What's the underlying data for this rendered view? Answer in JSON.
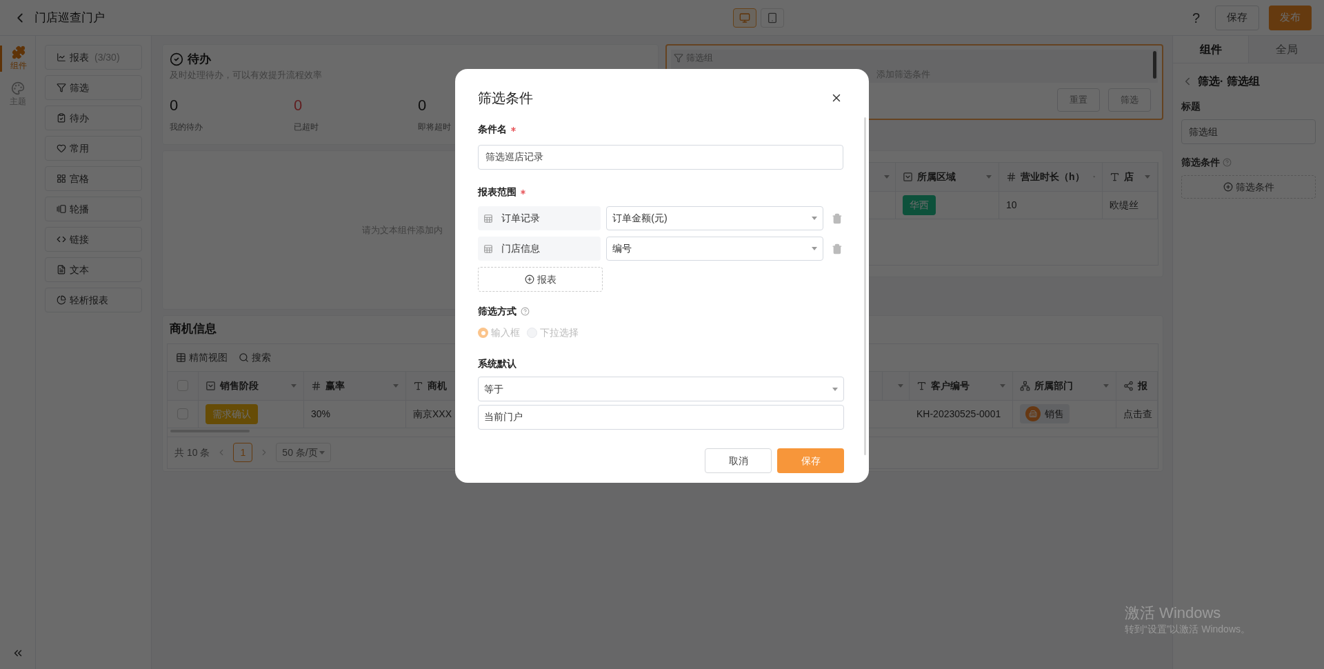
{
  "header": {
    "title": "门店巡查门户",
    "devices": [
      {
        "kind": "desktop",
        "selected": true
      },
      {
        "kind": "mobile",
        "selected": false
      }
    ],
    "help": "?",
    "buttons": [
      {
        "label": "保存",
        "kind": "default"
      },
      {
        "label": "发布",
        "kind": "primary"
      }
    ]
  },
  "rail": {
    "items": [
      {
        "label": "组件",
        "kind": "puzzle",
        "selected": true
      },
      {
        "label": "主题",
        "kind": "palette",
        "selected": false
      }
    ]
  },
  "components": [
    {
      "label": "报表",
      "count": "(3/30)",
      "kind": "chart"
    },
    {
      "label": "筛选",
      "kind": "filter"
    },
    {
      "label": "待办",
      "kind": "todo"
    },
    {
      "label": "常用",
      "kind": "heart"
    },
    {
      "label": "宫格",
      "kind": "grid"
    },
    {
      "label": "轮播",
      "kind": "carousel"
    },
    {
      "label": "链接",
      "kind": "code"
    },
    {
      "label": "文本",
      "kind": "text"
    },
    {
      "label": "轻析报表",
      "kind": "analysis"
    }
  ],
  "todo": {
    "title": "待办",
    "subtitle": "及时处理待办，可以有效提升流程效率",
    "stats": [
      {
        "value": "0",
        "label": "我的待办",
        "alert": false
      },
      {
        "value": "0",
        "label": "已超时",
        "alert": true
      },
      {
        "value": "0",
        "label": "即将超时",
        "alert": false
      }
    ]
  },
  "filter_group": {
    "title": "筛选组",
    "placeholder": "添加筛选条件",
    "buttons": [
      "重置",
      "筛选"
    ]
  },
  "text_card": {
    "placeholder": "请为文本组件添加内"
  },
  "store_table": {
    "columns": [
      {
        "label": "所属区域",
        "kind": "select"
      },
      {
        "label": "营业时长（h）",
        "kind": "number"
      },
      {
        "label": "店",
        "kind": "text"
      }
    ],
    "row": [
      {
        "kind": "green_tag",
        "text": "华西"
      },
      {
        "kind": "text",
        "text": "10"
      },
      {
        "kind": "text",
        "text": "欧缇丝"
      }
    ]
  },
  "opportunity": {
    "title": "商机信息",
    "toolbar": [
      {
        "label": "精简视图",
        "kind": "grid"
      },
      {
        "label": "搜索",
        "kind": "search"
      }
    ],
    "left_columns": [
      {
        "label": "销售阶段",
        "kind": "select"
      },
      {
        "label": "赢率",
        "kind": "number"
      },
      {
        "label": "商机",
        "kind": "text"
      }
    ],
    "all_checked": false,
    "row_checked": false,
    "left_row": [
      {
        "kind": "gold_tag",
        "text": "需求确认"
      },
      {
        "kind": "text",
        "text": "30%"
      },
      {
        "kind": "text",
        "text": "南京XXX"
      }
    ],
    "right_columns": [
      {
        "label": "客户编号",
        "kind": "text"
      },
      {
        "label": "所属部门",
        "kind": "org"
      },
      {
        "label": "报",
        "kind": "nodes"
      }
    ],
    "right_row": [
      {
        "kind": "text",
        "text": "KH-20230525-0001"
      },
      {
        "kind": "dept",
        "text": "销售"
      },
      {
        "kind": "text",
        "text": "点击查"
      }
    ],
    "pagination": {
      "total": "共 10 条",
      "pages": [
        {
          "label": "1",
          "selected": true
        }
      ],
      "page_size": "50 条/页"
    }
  },
  "right_panel": {
    "tabs": [
      {
        "label": "组件",
        "selected": true
      },
      {
        "label": "全局",
        "selected": false
      }
    ],
    "breadcrumb": "筛选· 筛选组",
    "title_label": "标题",
    "title_value": "筛选组",
    "conditions_label": "筛选条件",
    "add_condition": "筛选条件"
  },
  "dialog": {
    "title": "筛选条件",
    "name_label": "条件名",
    "name_required": true,
    "name_value": "筛选巡店记录",
    "scope_label": "报表范围",
    "scope_required": true,
    "scope_rows": [
      {
        "report": "订单记录",
        "field": "订单金额(元)"
      },
      {
        "report": "门店信息",
        "field": "编号"
      }
    ],
    "add_report": "报表",
    "mode_label": "筛选方式",
    "mode_disabled": true,
    "mode_options": [
      {
        "label": "输入框",
        "selected": true
      },
      {
        "label": "下拉选择",
        "selected": false
      }
    ],
    "default_label": "系统默认",
    "operator": "等于",
    "default_value": "当前门户",
    "buttons": [
      {
        "label": "取消",
        "kind": "default"
      },
      {
        "label": "保存",
        "kind": "primary"
      }
    ]
  },
  "watermark": {
    "title": "激活 Windows",
    "subtitle": "转到“设置”以激活 Windows。"
  }
}
